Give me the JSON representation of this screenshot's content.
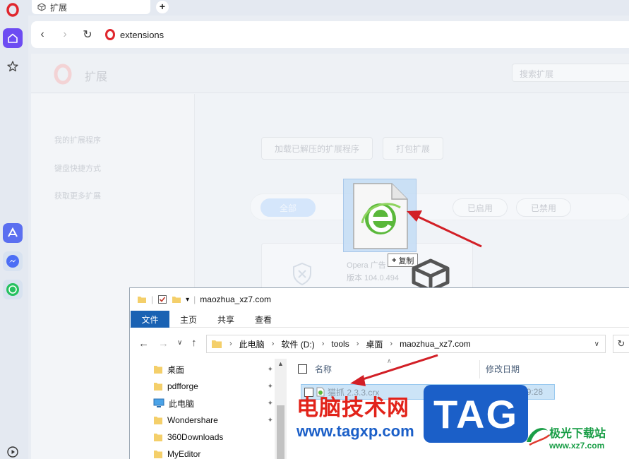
{
  "browser": {
    "tab_title": "扩展",
    "new_tab_label": "+",
    "url": "extensions"
  },
  "ext_page": {
    "title": "扩展",
    "search_placeholder": "搜索扩展",
    "nav": [
      "我的扩展程序",
      "键盘快捷方式",
      "获取更多扩展"
    ],
    "buttons": [
      "加载已解压的扩展程序",
      "打包扩展"
    ],
    "filters": [
      "全部",
      "已启用",
      "已禁用"
    ],
    "card": {
      "name": "Opera 广告",
      "version": "版本 104.0.494"
    }
  },
  "drag": {
    "copy_label": "复制"
  },
  "explorer": {
    "window_title": "maozhua_xz7.com",
    "ribbon": {
      "file": "文件",
      "home": "主页",
      "share": "共享",
      "view": "查看"
    },
    "path": [
      "此电脑",
      "软件 (D:)",
      "tools",
      "桌面",
      "maozhua_xz7.com"
    ],
    "tree": [
      {
        "label": "桌面",
        "pinned": true
      },
      {
        "label": "pdfforge",
        "pinned": true
      },
      {
        "label": "此电脑",
        "pinned": true
      },
      {
        "label": "Wondershare",
        "pinned": true
      },
      {
        "label": "360Downloads",
        "pinned": false
      },
      {
        "label": "MyEditor",
        "pinned": false
      }
    ],
    "columns": {
      "name": "名称",
      "date": "修改日期"
    },
    "file": {
      "name": "猫抓 2.3.3.crx",
      "date": "2023/4/10 9:28"
    }
  },
  "watermark": {
    "cn": "电脑技术网",
    "url": "www.tagxp.com",
    "tag": "TAG",
    "site_cn": "极光下载站",
    "site_url": "www.xz7.com"
  },
  "colors": {
    "accent": "#6d4cf2",
    "opera_red": "#e0262d",
    "file_tab": "#1a62b3",
    "arrow": "#d21f26"
  }
}
